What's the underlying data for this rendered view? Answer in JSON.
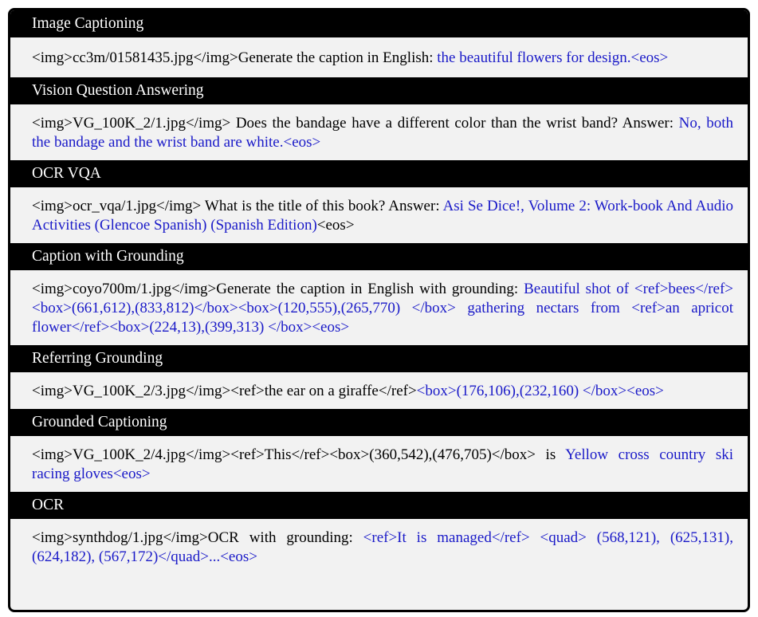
{
  "sections": [
    {
      "header": "Image Captioning",
      "prompt": "<img>cc3m/01581435.jpg</img>Generate the caption in English: ",
      "answer": "the beautiful flowers for design.<eos>",
      "suffix": ""
    },
    {
      "header": "Vision Question Answering",
      "prompt": "<img>VG_100K_2/1.jpg</img> Does the bandage have a different color than the wrist band? Answer: ",
      "answer": "No, both the bandage and the wrist band are white.<eos>",
      "suffix": ""
    },
    {
      "header": "OCR VQA",
      "prompt": "<img>ocr_vqa/1.jpg</img> What is the title of this book? Answer: ",
      "answer": "Asi Se Dice!, Volume 2: Work-book And Audio Activities (Glencoe Spanish) (Spanish Edition)",
      "suffix": "<eos>"
    },
    {
      "header": "Caption with Grounding",
      "prompt": "<img>coyo700m/1.jpg</img>Generate the caption in English with grounding: ",
      "answer": "Beautiful shot of <ref>bees</ref><box>(661,612),(833,812)</box><box>(120,555),(265,770) </box> gathering nectars from <ref>an apricot flower</ref><box>(224,13),(399,313) </box><eos>",
      "suffix": ""
    },
    {
      "header": "Referring Grounding",
      "prompt": "<img>VG_100K_2/3.jpg</img><ref>the ear on a giraffe</ref>",
      "answer": "<box>(176,106),(232,160) </box><eos>",
      "suffix": ""
    },
    {
      "header": "Grounded Captioning",
      "prompt": "<img>VG_100K_2/4.jpg</img><ref>This</ref><box>(360,542),(476,705)</box> is ",
      "answer": "Yellow cross country ski racing gloves<eos>",
      "suffix": ""
    },
    {
      "header": "OCR",
      "prompt": "<img>synthdog/1.jpg</img>OCR with grounding: ",
      "answer": "<ref>It is managed</ref> <quad> (568,121), (625,131), (624,182), (567,172)</quad>...<eos>",
      "suffix": ""
    }
  ]
}
